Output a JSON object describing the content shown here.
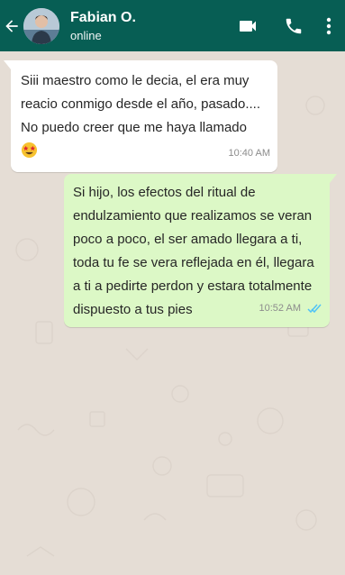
{
  "header": {
    "contact_name": "Fabian O.",
    "contact_status": "online",
    "icons": [
      "back-arrow-icon",
      "video-call-icon",
      "phone-icon",
      "more-vert-icon"
    ],
    "bg_color": "#075e54"
  },
  "messages": [
    {
      "direction": "incoming",
      "text": "Siii maestro como le decia, el era muy reacio conmigo desde el año, pasado.... No puedo creer que me haya llamado",
      "emoji": "star-struck-emoji",
      "time": "10:40 AM",
      "bubble_color": "#ffffff"
    },
    {
      "direction": "outgoing",
      "text": "Si hijo, los efectos del ritual de endulzamiento que realizamos se veran poco a poco, el ser amado llegara a ti, toda tu fe se vera reflejada en él, llegara a ti a pedirte perdon y estara totalmente dispuesto a tus pies",
      "time": "10:52 AM",
      "status_icon": "double-check-read-icon",
      "bubble_color": "#dcf8c6"
    }
  ],
  "chat_background": "#e5ddd5"
}
